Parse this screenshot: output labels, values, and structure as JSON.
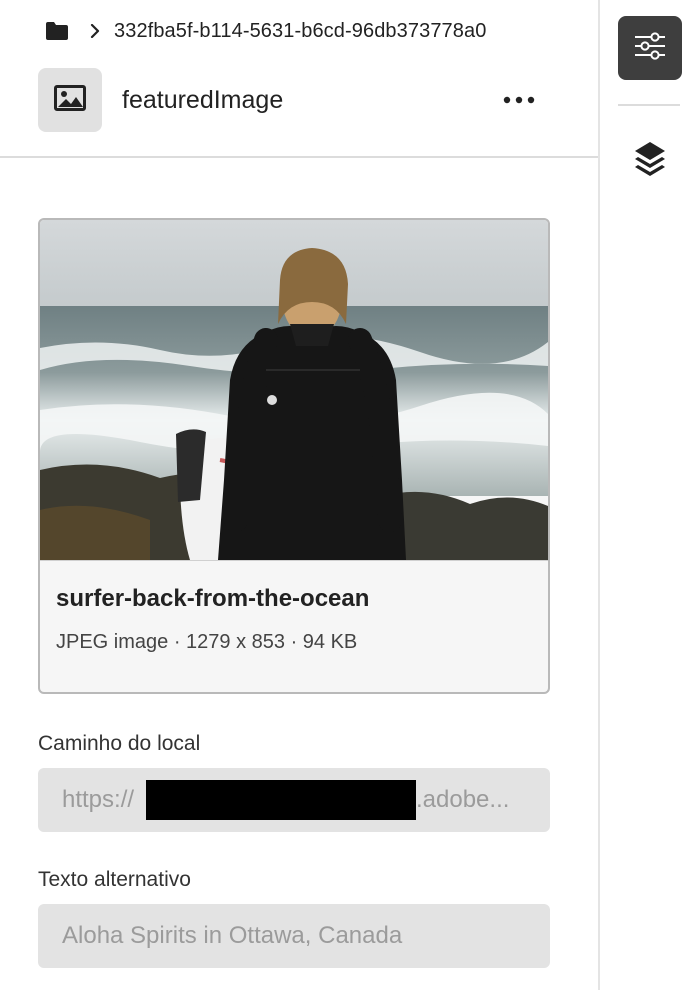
{
  "breadcrumb": {
    "folder_icon": "folder-icon",
    "chevron_icon": "chevron-right-icon",
    "path": "332fba5f-b114-5631-b6cd-96db373778a0"
  },
  "header": {
    "component_icon": "image-icon",
    "component_name": "featuredImage",
    "more_icon": "more-icon"
  },
  "rail": {
    "properties_icon": "sliders-icon",
    "layers_icon": "layers-icon"
  },
  "asset": {
    "title": "surfer-back-from-the-ocean",
    "details": "JPEG image · 1279 x 853 · 94 KB"
  },
  "fields": {
    "location_label": "Caminho do local",
    "location_value_start": "https://",
    "location_value_end": ".adobe...",
    "alt_label": "Texto alternativo",
    "alt_value": "Aloha Spirits in Ottawa, Canada"
  },
  "colors": {
    "rail_active": "#3e3e3e",
    "field_bg": "#e3e3e3",
    "card_bg": "#f6f6f6"
  }
}
